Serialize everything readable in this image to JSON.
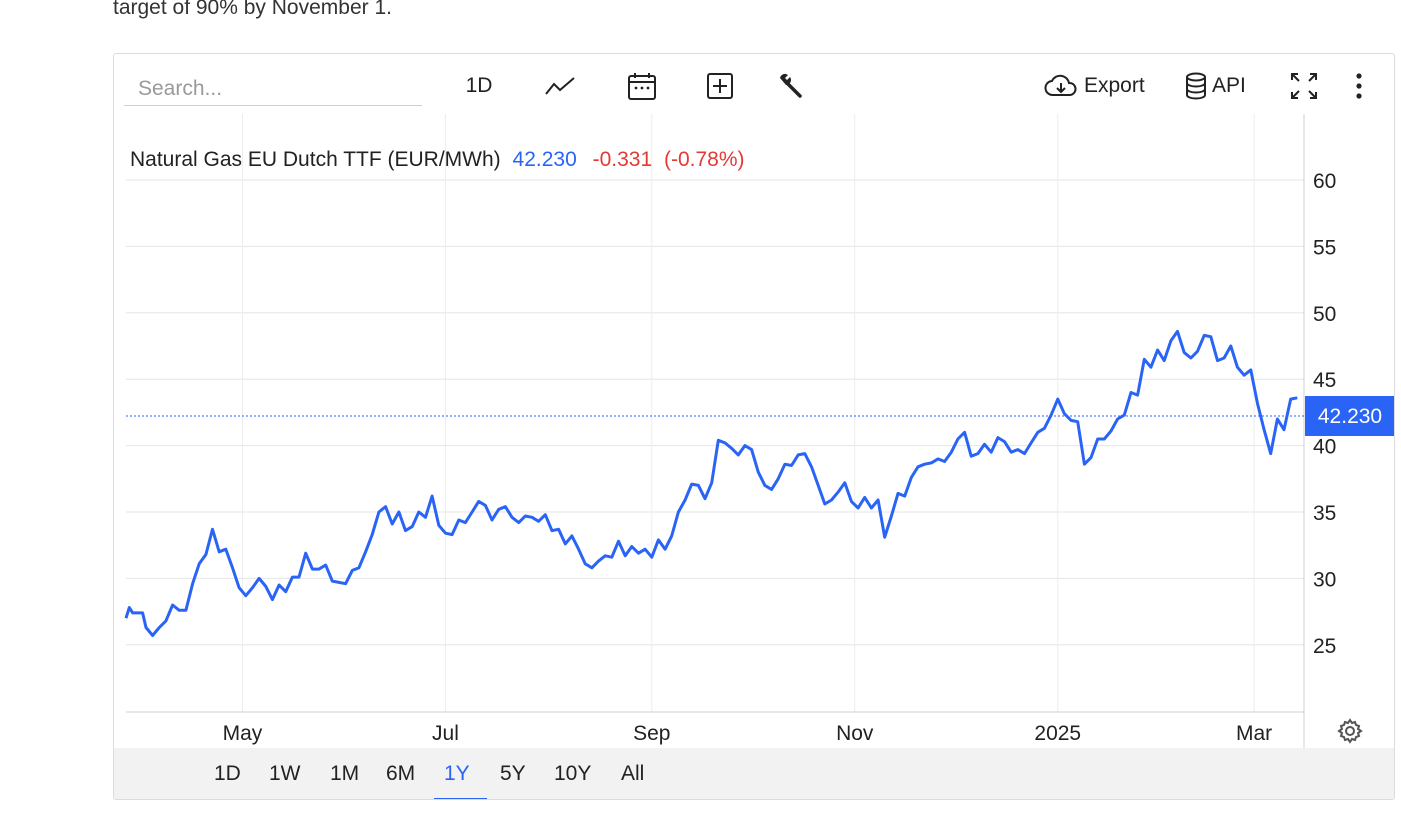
{
  "intro_text": "target of 90% by November 1.",
  "toolbar": {
    "search_placeholder": "Search...",
    "interval_label": "1D",
    "line_icon": "line-chart-icon",
    "calendar_icon": "calendar-icon",
    "add_icon": "plus-box-icon",
    "wrench_icon": "wrench-icon",
    "export_label": "Export",
    "api_label": "API",
    "fullscreen_icon": "fullscreen-icon",
    "more_icon": "more-vertical-icon"
  },
  "ranges": [
    "1D",
    "1W",
    "1M",
    "6M",
    "1Y",
    "5Y",
    "10Y",
    "All"
  ],
  "active_range": "1Y",
  "colors": {
    "line": "#2a64f6",
    "down": "#e53935",
    "accent": "#2a64f6"
  },
  "chart_data": {
    "type": "line",
    "title": "Natural Gas EU Dutch TTF (EUR/MWh)",
    "last_value": "42.230",
    "change": "-0.331",
    "change_pct": "(-0.78%)",
    "xlabel": "",
    "ylabel": "",
    "ylim": [
      20,
      65
    ],
    "yticks": [
      25,
      30,
      35,
      40,
      45,
      50,
      55,
      60
    ],
    "xticks": [
      {
        "label": "May",
        "date": "2024-05-01"
      },
      {
        "label": "Jul",
        "date": "2024-07-01"
      },
      {
        "label": "Sep",
        "date": "2024-09-01"
      },
      {
        "label": "Nov",
        "date": "2024-11-01"
      },
      {
        "label": "2025",
        "date": "2025-01-01"
      },
      {
        "label": "Mar",
        "date": "2025-03-01"
      }
    ],
    "grid": true,
    "x_range": [
      "2024-03-27",
      "2025-03-16"
    ],
    "series": [
      {
        "values": [
          [
            "2024-03-27",
            27.0
          ],
          [
            "2024-03-28",
            27.8
          ],
          [
            "2024-03-29",
            27.4
          ],
          [
            "2024-04-01",
            27.4
          ],
          [
            "2024-04-02",
            26.3
          ],
          [
            "2024-04-04",
            25.7
          ],
          [
            "2024-04-06",
            26.3
          ],
          [
            "2024-04-08",
            26.8
          ],
          [
            "2024-04-10",
            28.0
          ],
          [
            "2024-04-12",
            27.6
          ],
          [
            "2024-04-14",
            27.6
          ],
          [
            "2024-04-16",
            29.6
          ],
          [
            "2024-04-18",
            31.1
          ],
          [
            "2024-04-20",
            31.8
          ],
          [
            "2024-04-22",
            33.7
          ],
          [
            "2024-04-24",
            32.0
          ],
          [
            "2024-04-26",
            32.2
          ],
          [
            "2024-04-28",
            30.8
          ],
          [
            "2024-04-30",
            29.3
          ],
          [
            "2024-05-02",
            28.7
          ],
          [
            "2024-05-04",
            29.3
          ],
          [
            "2024-05-06",
            30.0
          ],
          [
            "2024-05-08",
            29.4
          ],
          [
            "2024-05-10",
            28.4
          ],
          [
            "2024-05-12",
            29.5
          ],
          [
            "2024-05-14",
            29.0
          ],
          [
            "2024-05-16",
            30.1
          ],
          [
            "2024-05-18",
            30.1
          ],
          [
            "2024-05-20",
            31.9
          ],
          [
            "2024-05-22",
            30.7
          ],
          [
            "2024-05-24",
            30.7
          ],
          [
            "2024-05-26",
            31.0
          ],
          [
            "2024-05-28",
            29.8
          ],
          [
            "2024-05-30",
            29.7
          ],
          [
            "2024-06-01",
            29.6
          ],
          [
            "2024-06-03",
            30.6
          ],
          [
            "2024-06-05",
            30.8
          ],
          [
            "2024-06-07",
            32.0
          ],
          [
            "2024-06-09",
            33.3
          ],
          [
            "2024-06-11",
            35.0
          ],
          [
            "2024-06-13",
            35.4
          ],
          [
            "2024-06-15",
            34.1
          ],
          [
            "2024-06-17",
            35.0
          ],
          [
            "2024-06-19",
            33.6
          ],
          [
            "2024-06-21",
            33.9
          ],
          [
            "2024-06-23",
            35.0
          ],
          [
            "2024-06-25",
            34.6
          ],
          [
            "2024-06-27",
            36.2
          ],
          [
            "2024-06-29",
            34.0
          ],
          [
            "2024-07-01",
            33.4
          ],
          [
            "2024-07-03",
            33.3
          ],
          [
            "2024-07-05",
            34.4
          ],
          [
            "2024-07-07",
            34.2
          ],
          [
            "2024-07-09",
            35.0
          ],
          [
            "2024-07-11",
            35.8
          ],
          [
            "2024-07-13",
            35.5
          ],
          [
            "2024-07-15",
            34.4
          ],
          [
            "2024-07-17",
            35.2
          ],
          [
            "2024-07-19",
            35.4
          ],
          [
            "2024-07-21",
            34.6
          ],
          [
            "2024-07-23",
            34.2
          ],
          [
            "2024-07-25",
            34.7
          ],
          [
            "2024-07-27",
            34.6
          ],
          [
            "2024-07-29",
            34.3
          ],
          [
            "2024-07-31",
            34.8
          ],
          [
            "2024-08-02",
            33.6
          ],
          [
            "2024-08-04",
            33.7
          ],
          [
            "2024-08-06",
            32.6
          ],
          [
            "2024-08-08",
            33.2
          ],
          [
            "2024-08-10",
            32.2
          ],
          [
            "2024-08-12",
            31.1
          ],
          [
            "2024-08-14",
            30.8
          ],
          [
            "2024-08-16",
            31.3
          ],
          [
            "2024-08-18",
            31.7
          ],
          [
            "2024-08-20",
            31.6
          ],
          [
            "2024-08-22",
            32.8
          ],
          [
            "2024-08-24",
            31.7
          ],
          [
            "2024-08-26",
            32.4
          ],
          [
            "2024-08-28",
            31.9
          ],
          [
            "2024-08-30",
            32.2
          ],
          [
            "2024-09-01",
            31.6
          ],
          [
            "2024-09-03",
            32.9
          ],
          [
            "2024-09-05",
            32.2
          ],
          [
            "2024-09-07",
            33.2
          ],
          [
            "2024-09-09",
            35.0
          ],
          [
            "2024-09-11",
            35.9
          ],
          [
            "2024-09-13",
            37.1
          ],
          [
            "2024-09-15",
            37.0
          ],
          [
            "2024-09-17",
            36.0
          ],
          [
            "2024-09-19",
            37.2
          ],
          [
            "2024-09-21",
            40.4
          ],
          [
            "2024-09-23",
            40.2
          ],
          [
            "2024-09-25",
            39.8
          ],
          [
            "2024-09-27",
            39.3
          ],
          [
            "2024-09-29",
            40.0
          ],
          [
            "2024-10-01",
            39.7
          ],
          [
            "2024-10-03",
            38.0
          ],
          [
            "2024-10-05",
            37.0
          ],
          [
            "2024-10-07",
            36.7
          ],
          [
            "2024-10-09",
            37.5
          ],
          [
            "2024-10-11",
            38.6
          ],
          [
            "2024-10-13",
            38.5
          ],
          [
            "2024-10-15",
            39.3
          ],
          [
            "2024-10-17",
            39.4
          ],
          [
            "2024-10-19",
            38.4
          ],
          [
            "2024-10-21",
            37.0
          ],
          [
            "2024-10-23",
            35.6
          ],
          [
            "2024-10-25",
            35.9
          ],
          [
            "2024-10-27",
            36.5
          ],
          [
            "2024-10-29",
            37.2
          ],
          [
            "2024-10-31",
            35.8
          ],
          [
            "2024-11-02",
            35.3
          ],
          [
            "2024-11-04",
            36.1
          ],
          [
            "2024-11-06",
            35.3
          ],
          [
            "2024-11-08",
            35.9
          ],
          [
            "2024-11-10",
            33.1
          ],
          [
            "2024-11-12",
            34.7
          ],
          [
            "2024-11-14",
            36.4
          ],
          [
            "2024-11-16",
            36.2
          ],
          [
            "2024-11-18",
            37.6
          ],
          [
            "2024-11-20",
            38.4
          ],
          [
            "2024-11-22",
            38.6
          ],
          [
            "2024-11-24",
            38.7
          ],
          [
            "2024-11-26",
            39.0
          ],
          [
            "2024-11-28",
            38.8
          ],
          [
            "2024-11-30",
            39.5
          ],
          [
            "2024-12-02",
            40.5
          ],
          [
            "2024-12-04",
            41.0
          ],
          [
            "2024-12-06",
            39.2
          ],
          [
            "2024-12-08",
            39.4
          ],
          [
            "2024-12-10",
            40.1
          ],
          [
            "2024-12-12",
            39.5
          ],
          [
            "2024-12-14",
            40.6
          ],
          [
            "2024-12-16",
            40.3
          ],
          [
            "2024-12-18",
            39.5
          ],
          [
            "2024-12-20",
            39.7
          ],
          [
            "2024-12-22",
            39.4
          ],
          [
            "2024-12-24",
            40.2
          ],
          [
            "2024-12-26",
            41.0
          ],
          [
            "2024-12-28",
            41.3
          ],
          [
            "2024-12-30",
            42.3
          ],
          [
            "2025-01-01",
            43.5
          ],
          [
            "2025-01-03",
            42.4
          ],
          [
            "2025-01-05",
            41.9
          ],
          [
            "2025-01-07",
            41.8
          ],
          [
            "2025-01-09",
            38.6
          ],
          [
            "2025-01-11",
            39.1
          ],
          [
            "2025-01-13",
            40.5
          ],
          [
            "2025-01-15",
            40.5
          ],
          [
            "2025-01-17",
            41.1
          ],
          [
            "2025-01-19",
            42.0
          ],
          [
            "2025-01-21",
            42.3
          ],
          [
            "2025-01-23",
            44.0
          ],
          [
            "2025-01-25",
            43.8
          ],
          [
            "2025-01-27",
            46.5
          ],
          [
            "2025-01-29",
            45.9
          ],
          [
            "2025-01-31",
            47.2
          ],
          [
            "2025-02-02",
            46.4
          ],
          [
            "2025-02-04",
            47.9
          ],
          [
            "2025-02-06",
            48.6
          ],
          [
            "2025-02-08",
            47.0
          ],
          [
            "2025-02-10",
            46.6
          ],
          [
            "2025-02-12",
            47.1
          ],
          [
            "2025-02-14",
            48.3
          ],
          [
            "2025-02-16",
            48.2
          ],
          [
            "2025-02-18",
            46.4
          ],
          [
            "2025-02-20",
            46.6
          ],
          [
            "2025-02-22",
            47.5
          ],
          [
            "2025-02-24",
            45.9
          ],
          [
            "2025-02-26",
            45.3
          ],
          [
            "2025-02-28",
            45.7
          ],
          [
            "2025-03-02",
            43.2
          ],
          [
            "2025-03-04",
            41.2
          ],
          [
            "2025-03-06",
            39.4
          ],
          [
            "2025-03-08",
            42.0
          ],
          [
            "2025-03-10",
            41.2
          ],
          [
            "2025-03-12",
            43.5
          ],
          [
            "2025-03-14",
            43.6
          ]
        ]
      }
    ]
  }
}
